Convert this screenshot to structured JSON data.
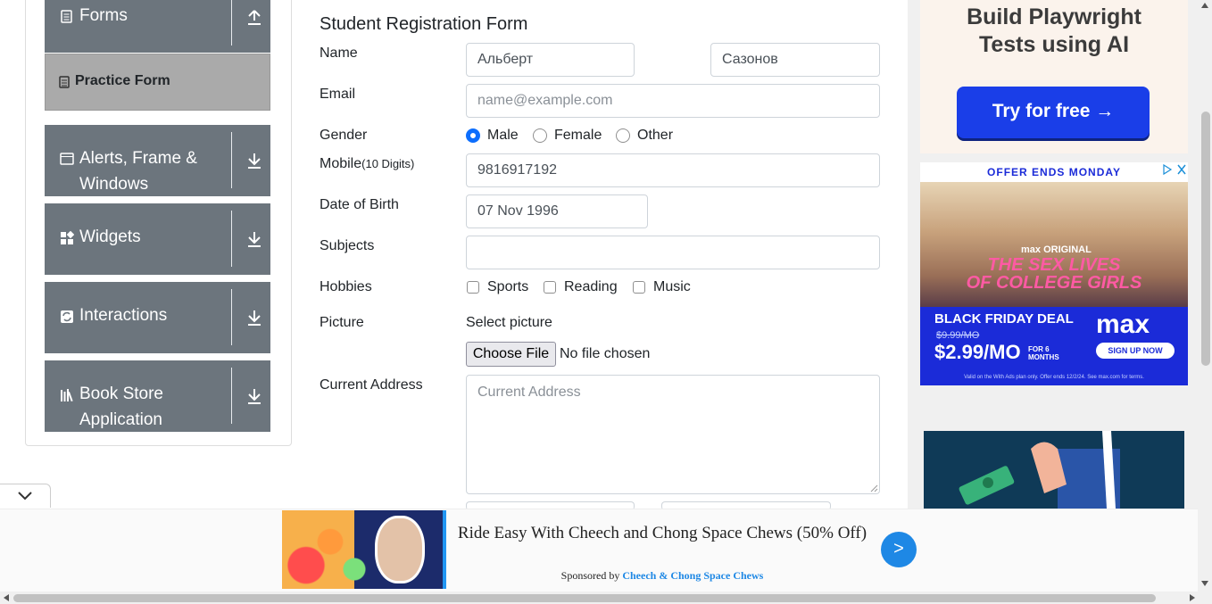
{
  "sidebar": {
    "forms": {
      "label": "Forms"
    },
    "practice": {
      "label": "Practice Form"
    },
    "alerts": {
      "label_line1": "Alerts, Frame &",
      "label_line2": "Windows"
    },
    "widgets": {
      "label": "Widgets"
    },
    "interactions": {
      "label": "Interactions"
    },
    "bookstore": {
      "label_line1": "Book Store",
      "label_line2": "Application"
    }
  },
  "form": {
    "title": "Student Registration Form",
    "name_label": "Name",
    "first_name": "Альберт",
    "last_name": "Сазонов",
    "email_label": "Email",
    "email_placeholder": "name@example.com",
    "gender_label": "Gender",
    "gender_options": [
      "Male",
      "Female",
      "Other"
    ],
    "gender_selected": "Male",
    "mobile_label": "Mobile",
    "mobile_hint": "(10 Digits)",
    "mobile_value": "9816917192",
    "dob_label": "Date of Birth",
    "dob_value": "07 Nov 1996",
    "subjects_label": "Subjects",
    "hobbies_label": "Hobbies",
    "hobbies": [
      "Sports",
      "Reading",
      "Music"
    ],
    "picture_label": "Picture",
    "select_picture": "Select picture",
    "choose_file": "Choose File",
    "no_file": "No file chosen",
    "address_label": "Current Address",
    "address_placeholder": "Current Address"
  },
  "ads": {
    "playwright": {
      "line1": "Build Playwright",
      "line2": "Tests using AI",
      "button": "Try for free →"
    },
    "max": {
      "offer": "OFFER ENDS MONDAY",
      "show_line1": "THE SEX LIVES",
      "show_line2": "OF COLLEGE GIRLS",
      "original": "max ORIGINAL",
      "deal": "BLACK FRIDAY DEAL",
      "old_price": "$9.99/MO",
      "price": "$2.99/MO",
      "months": "FOR 6 MONTHS",
      "logo": "max",
      "signup": "SIGN UP NOW",
      "fine": "Valid on the With Ads plan only. Offer ends 12/2/24. See max.com for terms."
    },
    "banner": {
      "title": "Ride Easy With Cheech and Chong Space Chews (50% Off)",
      "sponsored_by": "Sponsored by",
      "sponsor": "Cheech & Chong Space Chews",
      "go": ">"
    }
  },
  "colors": {
    "sidebar_bg": "#6c757d",
    "accent": "#0d6efd",
    "practice_bg": "#aaaaaa"
  }
}
